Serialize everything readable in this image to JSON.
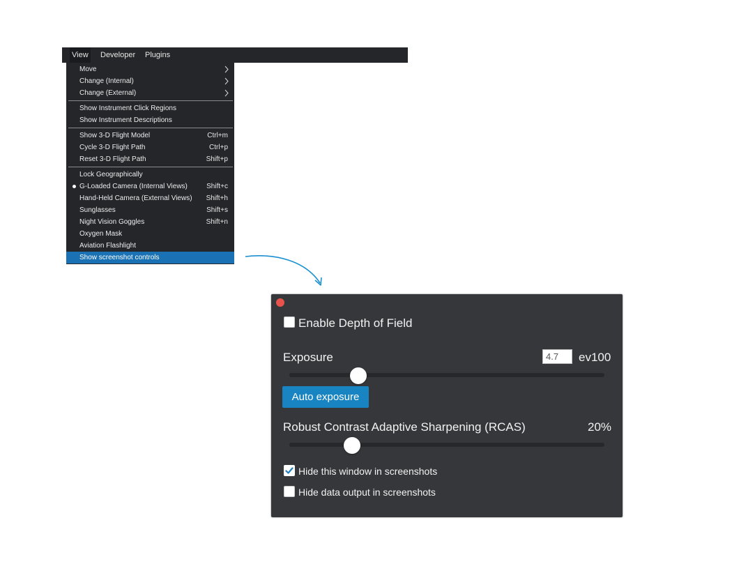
{
  "menubar": {
    "items": [
      "View",
      "Developer",
      "Plugins"
    ]
  },
  "dropdown": {
    "groups": [
      [
        {
          "label": "Move",
          "submenu": true
        },
        {
          "label": "Change (Internal)",
          "submenu": true
        },
        {
          "label": "Change (External)",
          "submenu": true
        }
      ],
      [
        {
          "label": "Show Instrument Click Regions"
        },
        {
          "label": "Show Instrument Descriptions"
        }
      ],
      [
        {
          "label": "Show 3-D Flight Model",
          "shortcut": "Ctrl+m"
        },
        {
          "label": "Cycle 3-D Flight Path",
          "shortcut": "Ctrl+p"
        },
        {
          "label": "Reset 3-D Flight Path",
          "shortcut": "Shift+p"
        }
      ],
      [
        {
          "label": "Lock Geographically"
        },
        {
          "label": "G-Loaded Camera (Internal Views)",
          "shortcut": "Shift+c",
          "selected": true
        },
        {
          "label": "Hand-Held Camera (External Views)",
          "shortcut": "Shift+h"
        },
        {
          "label": "Sunglasses",
          "shortcut": "Shift+s"
        },
        {
          "label": "Night Vision Goggles",
          "shortcut": "Shift+n"
        },
        {
          "label": "Oxygen Mask"
        },
        {
          "label": "Aviation Flashlight"
        },
        {
          "label": "Show screenshot controls",
          "highlighted": true
        }
      ]
    ]
  },
  "panel": {
    "depth_of_field": {
      "label": "Enable Depth of Field",
      "checked": false
    },
    "exposure": {
      "label": "Exposure",
      "value": "4.7",
      "unit": "ev100",
      "slider_fraction": 0.22
    },
    "auto_exposure_button": "Auto exposure",
    "rcas": {
      "label": "Robust Contrast Adaptive Sharpening (RCAS)",
      "value": "20%",
      "slider_fraction": 0.2
    },
    "hide_window": {
      "label": "Hide this window in screenshots",
      "checked": true
    },
    "hide_data": {
      "label": "Hide data output in screenshots",
      "checked": false
    }
  },
  "colors": {
    "menu_bg": "#24262a",
    "highlight": "#1a72b4",
    "panel_bg": "#35373b",
    "button": "#1884c2",
    "close": "#e8544b",
    "arrow": "#1a8fd0"
  }
}
